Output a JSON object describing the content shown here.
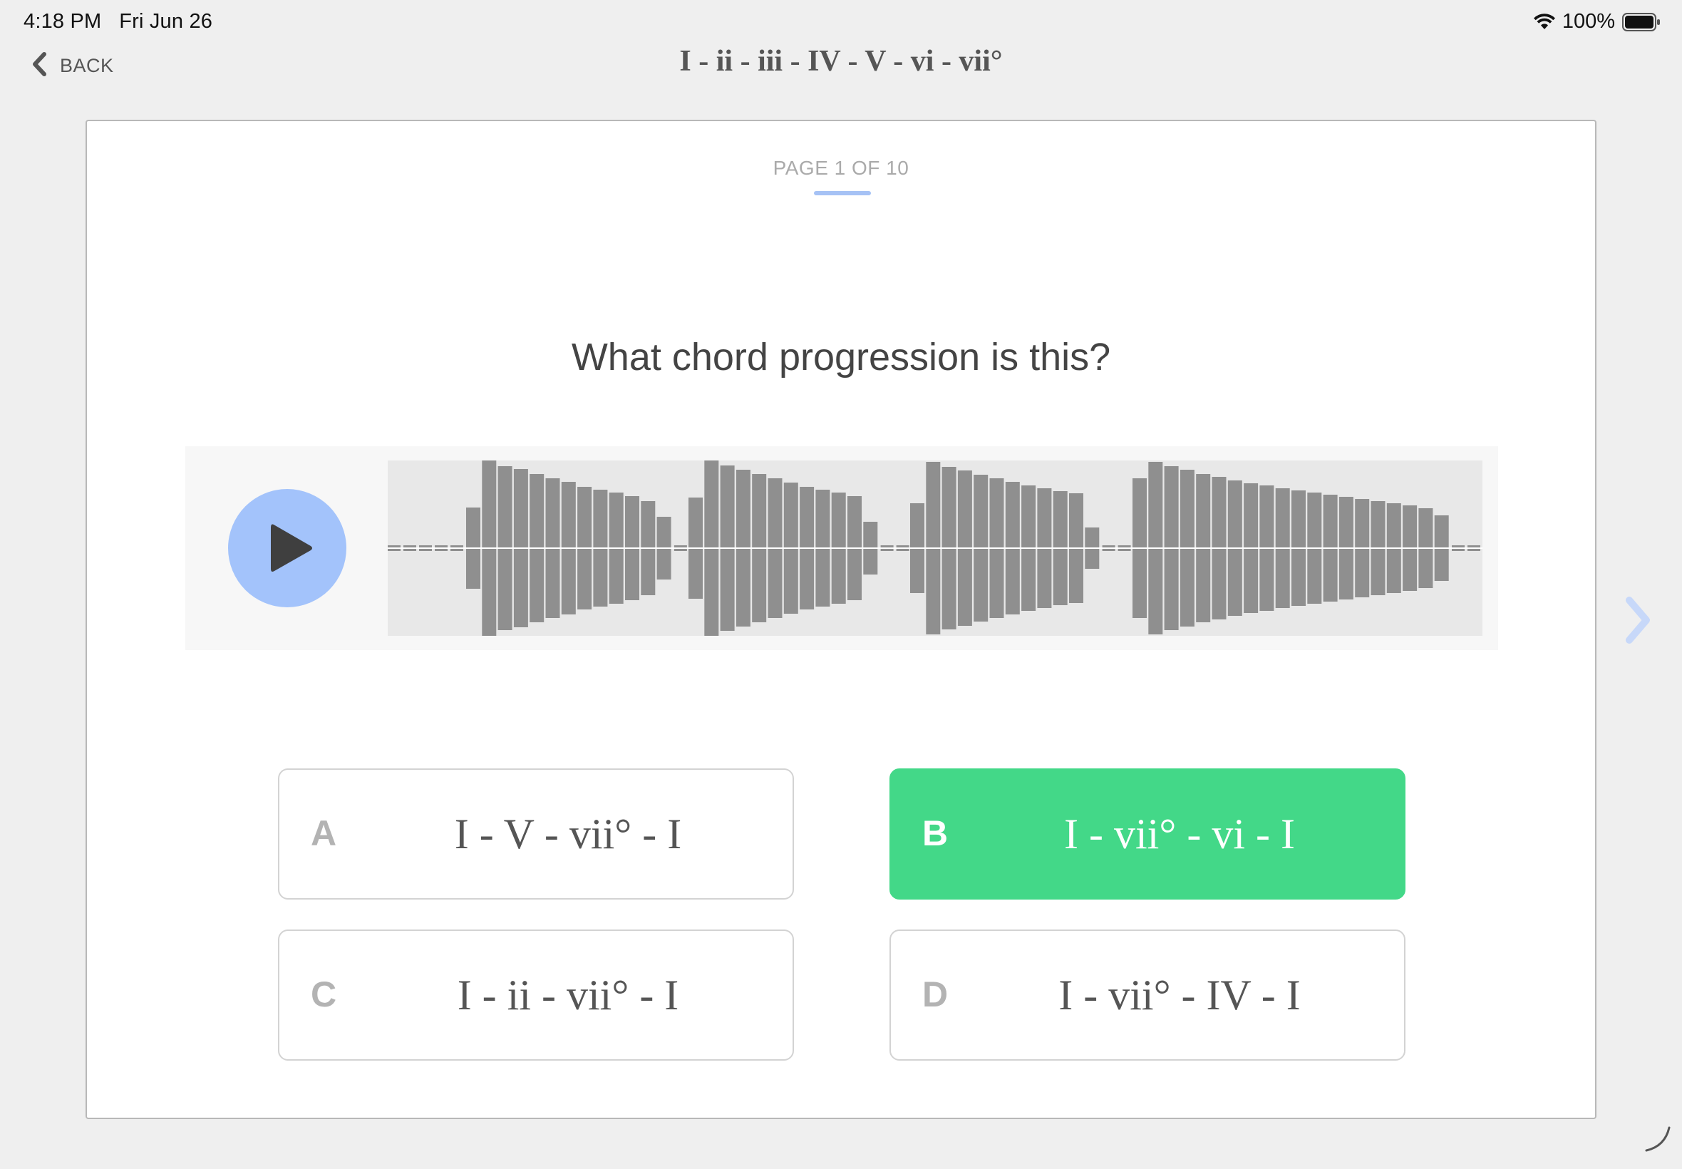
{
  "status_bar": {
    "time": "4:18 PM",
    "date": "Fri Jun 26",
    "battery": "100%",
    "icons": [
      "wifi-icon",
      "battery-icon"
    ]
  },
  "nav": {
    "back_label": "BACK",
    "title": "I - ii - iii - IV - V - vi - vii°"
  },
  "quiz": {
    "page_indicator": "PAGE 1 OF 10",
    "question": "What chord progression is this?",
    "audio": {
      "play_icon": "play-icon",
      "waveform": "waveform-icon"
    },
    "answers": [
      {
        "letter": "A",
        "text": "I - V - vii° - I",
        "state": "default"
      },
      {
        "letter": "B",
        "text": "I - vii° - vi - I",
        "state": "correct"
      },
      {
        "letter": "C",
        "text": "I - ii - vii° - I",
        "state": "default"
      },
      {
        "letter": "D",
        "text": "I - vii° - IV - I",
        "state": "default"
      }
    ]
  },
  "colors": {
    "background": "#efefef",
    "play_button": "#a3c3fb",
    "correct": "#43d888",
    "accent": "#a6c2f5",
    "waveform_bar": "#8f8f8f"
  }
}
